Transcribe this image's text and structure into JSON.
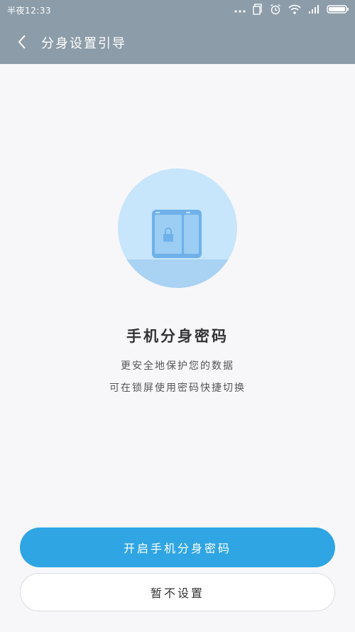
{
  "status_bar": {
    "time": "半夜12:33",
    "icons": [
      "dots-icon",
      "sim-icon",
      "alarm-icon",
      "wifi-icon",
      "signal-icon",
      "battery-icon"
    ]
  },
  "header": {
    "title": "分身设置引导"
  },
  "content": {
    "heading": "手机分身密码",
    "line1": "更安全地保护您的数据",
    "line2": "可在锁屏使用密码快捷切换"
  },
  "buttons": {
    "primary_label": "开启手机分身密码",
    "secondary_label": "暂不设置"
  },
  "colors": {
    "header_bg": "#8c9ca8",
    "primary": "#2fa5e3",
    "circle": "#c7e5fb"
  }
}
